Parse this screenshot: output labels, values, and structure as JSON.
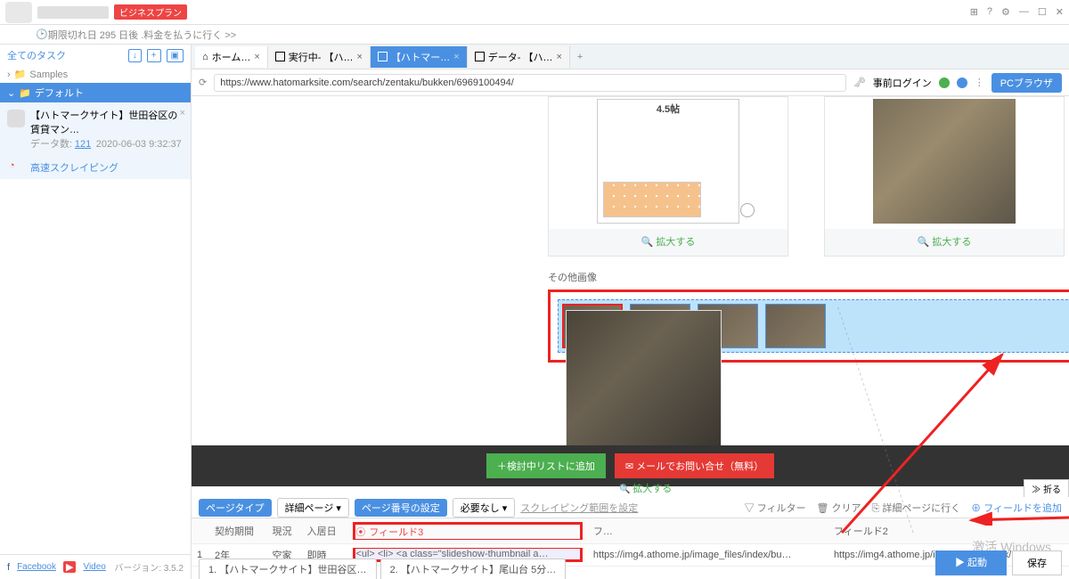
{
  "header": {
    "plan_badge": "ビジネスプラン",
    "expiry": "期限切れ日 295 日後 .料金を払うに行く >>",
    "win_icons": [
      "⊞",
      "?",
      "⚙",
      "—",
      "☐",
      "✕"
    ]
  },
  "sidebar": {
    "all_tasks": "全てのタスク",
    "samples": "Samples",
    "default_group": "デフォルト",
    "task": {
      "title": "【ハトマークサイト】世田谷区の賃貸マン…",
      "meta_label": "データ数:",
      "meta_count": "121",
      "meta_time": "2020-06-03 9:32:37"
    },
    "fast_scrape": "高速スクレイピング",
    "footer": {
      "fb": "Facebook",
      "video": "Video",
      "version": "バージョン: 3.5.2"
    }
  },
  "tabs": [
    {
      "label": "ホーム…",
      "kind": "home"
    },
    {
      "label": "実行中- 【ハ…"
    },
    {
      "label": "【ハトマー…",
      "active": true
    },
    {
      "label": "データ- 【ハ…"
    }
  ],
  "addr": {
    "url": "https://www.hatomarksite.com/search/zentaku/bukken/6969100494/",
    "prelogin": "事前ログイン",
    "pc": "PCブラウザ"
  },
  "page": {
    "floorplan_label": "4.5帖",
    "enlarge": "拡大する",
    "other_images": "その他画像",
    "btn_add_list": "＋検討中リストに追加",
    "btn_mail": "✉ メールでお問い合せ（無料）",
    "fold": "≫ 折る"
  },
  "config": {
    "page_type": "ページタイプ",
    "detail_page": "詳細ページ",
    "page_num": "ページ番号の設定",
    "need_none": "必要なし",
    "scrape_area": "スクレイピング範囲を設定",
    "filter": "フィルター",
    "clear": "クリア",
    "goto_detail": "詳細ページに行く",
    "add_field": "フィールドを追加"
  },
  "table": {
    "headers": [
      "契約期間",
      "現況",
      "入居日",
      "フィールド3",
      "フ…",
      "フィールド2"
    ],
    "row": [
      "1",
      "2年",
      "空家",
      "即時",
      "<ul> <li> <a class=\"slideshow-thumbnail a…",
      "https://img4.athome.jp/image_files/index/bu…",
      "https://img4.athome.jp/image_files/index/bu…"
    ]
  },
  "bottom_tabs": [
    "1. 【ハトマークサイト】世田谷区…",
    "2. 【ハトマークサイト】尾山台 5分…"
  ],
  "actions": {
    "run": "▶ 起動",
    "save": "保存"
  },
  "watermark": "激活 Windows"
}
